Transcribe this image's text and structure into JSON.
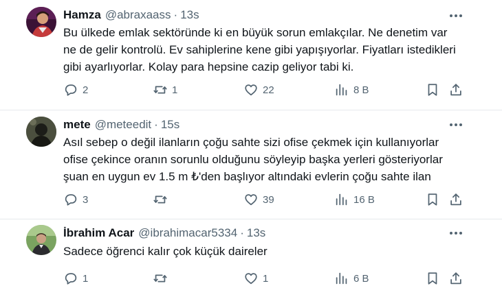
{
  "tweets": [
    {
      "name": "Hamza",
      "handle": "@abraxaass",
      "separator": "·",
      "time": "13s",
      "lines": [
        "Bu ülkede emlak sektöründe ki en büyük sorun emlakçılar. Ne denetim var",
        "ne de gelir kontrolü. Ev sahiplerine kene gibi yapışıyorlar. Fiyatları istedikleri",
        "gibi ayarlıyorlar. Kolay para hepsine cazip geliyor tabi ki."
      ],
      "replies": "2",
      "reposts": "1",
      "likes": "22",
      "views": "8 B"
    },
    {
      "name": "mete",
      "handle": "@meteedit",
      "separator": "·",
      "time": "15s",
      "lines": [
        "Asıl sebep o değil ilanların çoğu sahte sizi ofise çekmek için kullanıyorlar",
        "ofise çekince oranın sorunlu olduğunu söyleyip başka yerleri gösteriyorlar",
        "şuan en uygun ev 1.5 m ₺'den başlıyor altındaki evlerin çoğu sahte ilan"
      ],
      "replies": "3",
      "reposts": "",
      "likes": "39",
      "views": "16 B"
    },
    {
      "name": "İbrahim Acar",
      "handle": "@ibrahimacar5334",
      "separator": "·",
      "time": "13s",
      "lines": [
        "Sadece öğrenci kalır çok küçük daireler"
      ],
      "replies": "1",
      "reposts": "",
      "likes": "1",
      "views": "6 B"
    }
  ],
  "icons": {
    "more": "more-dots-icon",
    "reply": "reply-bubble-icon",
    "repost": "repost-icon",
    "like": "heart-icon",
    "views": "views-bar-chart-icon",
    "bookmark": "bookmark-icon",
    "share": "share-icon"
  },
  "colors": {
    "text": "#0f1419",
    "secondary": "#536471",
    "divider": "#e6e9ec"
  }
}
